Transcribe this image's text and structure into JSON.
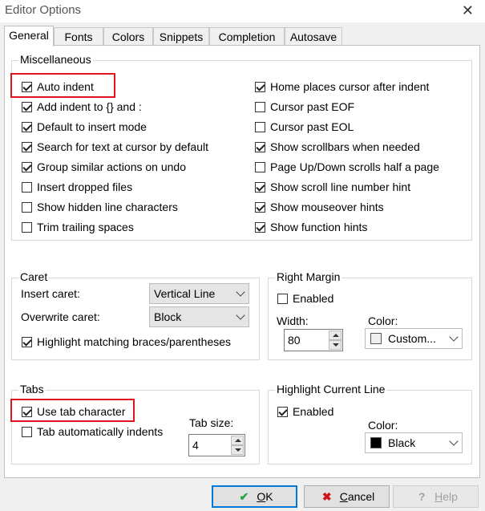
{
  "window": {
    "title": "Editor Options"
  },
  "tabs": [
    "General",
    "Fonts",
    "Colors",
    "Snippets",
    "Completion",
    "Autosave"
  ],
  "misc": {
    "legend": "Miscellaneous",
    "left": [
      {
        "label": "Auto indent",
        "checked": true
      },
      {
        "label": "Add indent to {} and :",
        "checked": true
      },
      {
        "label": "Default to insert mode",
        "checked": true
      },
      {
        "label": "Search for text at cursor by default",
        "checked": true
      },
      {
        "label": "Group similar actions on undo",
        "checked": true
      },
      {
        "label": "Insert dropped files",
        "checked": false
      },
      {
        "label": "Show hidden line characters",
        "checked": false
      },
      {
        "label": "Trim trailing spaces",
        "checked": false
      }
    ],
    "right": [
      {
        "label": "Home places cursor after indent",
        "checked": true
      },
      {
        "label": "Cursor past EOF",
        "checked": false
      },
      {
        "label": "Cursor past EOL",
        "checked": false
      },
      {
        "label": "Show scrollbars when needed",
        "checked": true
      },
      {
        "label": "Page Up/Down scrolls half a page",
        "checked": false
      },
      {
        "label": "Show scroll line number hint",
        "checked": true
      },
      {
        "label": "Show mouseover hints",
        "checked": true
      },
      {
        "label": "Show function hints",
        "checked": true
      }
    ]
  },
  "caret": {
    "legend": "Caret",
    "insert_label": "Insert caret:",
    "insert_value": "Vertical Line",
    "overwrite_label": "Overwrite caret:",
    "overwrite_value": "Block",
    "highlight_label": "Highlight matching braces/parentheses",
    "highlight_checked": true
  },
  "right_margin": {
    "legend": "Right Margin",
    "enabled_label": "Enabled",
    "enabled_checked": false,
    "width_label": "Width:",
    "width_value": "80",
    "color_label": "Color:",
    "color_value": "Custom...",
    "swatch_color": "#f0f0f0"
  },
  "tabs_group": {
    "legend": "Tabs",
    "use_tab_label": "Use tab character",
    "use_tab_checked": true,
    "auto_indent_label": "Tab automatically indents",
    "auto_indent_checked": false,
    "tab_size_label": "Tab size:",
    "tab_size_value": "4"
  },
  "highlight_line": {
    "legend": "Highlight Current Line",
    "enabled_label": "Enabled",
    "enabled_checked": true,
    "color_label": "Color:",
    "color_value": "Black",
    "swatch_color": "#000000"
  },
  "buttons": {
    "ok_icon": "✔",
    "ok_mnemonic": "O",
    "ok_rest": "K",
    "cancel_icon": "✖",
    "cancel_mnemonic": "C",
    "cancel_rest": "ancel",
    "help_icon": "?",
    "help_mnemonic": "H",
    "help_rest": "elp"
  },
  "colors": {
    "highlight_box": "#e0141e",
    "ok_check": "#2ea043",
    "cancel_x": "#d0141c",
    "accent": "#0078d7"
  }
}
